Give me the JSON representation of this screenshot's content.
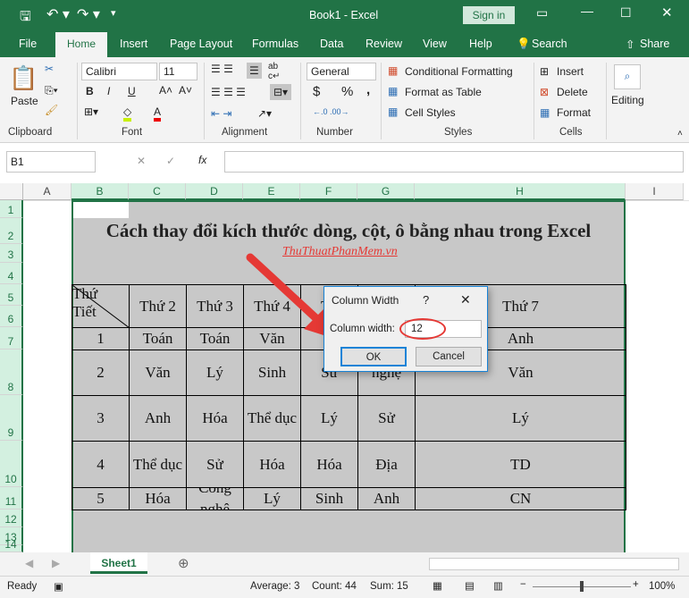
{
  "title": {
    "doc": "Book1  -  Excel",
    "signin": "Sign in"
  },
  "tabs": [
    "File",
    "Home",
    "Insert",
    "Page Layout",
    "Formulas",
    "Data",
    "Review",
    "View",
    "Help",
    "Search",
    "Share"
  ],
  "ribbon": {
    "clipboard": {
      "paste": "Paste",
      "label": "Clipboard"
    },
    "font": {
      "name": "Calibri",
      "size": "11",
      "label": "Font",
      "bold": "B",
      "italic": "I",
      "underline": "U"
    },
    "alignment": {
      "label": "Alignment"
    },
    "number": {
      "format": "General",
      "label": "Number",
      "currency": "$",
      "percent": "%",
      "comma": ","
    },
    "styles": {
      "conditional": "Conditional Formatting",
      "table": "Format as Table",
      "cell": "Cell Styles",
      "label": "Styles"
    },
    "cells": {
      "insert": "Insert",
      "delete": "Delete",
      "format": "Format",
      "label": "Cells"
    },
    "editing": {
      "label": "Editing"
    }
  },
  "formula_bar": {
    "name_box": "B1",
    "fx": "fx",
    "value": ""
  },
  "columns": [
    "A",
    "B",
    "C",
    "D",
    "E",
    "F",
    "G",
    "H",
    "I"
  ],
  "rows": [
    "1",
    "2",
    "3",
    "4",
    "5",
    "6",
    "7",
    "8",
    "9",
    "10",
    "11",
    "12",
    "13",
    "14"
  ],
  "sheet": {
    "title": "Cách thay đổi kích thước dòng, cột, ô bằng nhau trong Excel",
    "watermark": "ThuThuatPhanMem.vn",
    "corner_top": "Thứ",
    "corner_bottom": "Tiết",
    "headers": [
      "Thứ 2",
      "Thứ 3",
      "Thứ 4",
      "Th",
      "",
      "Thứ 7"
    ],
    "body": [
      [
        "1",
        "Toán",
        "Toán",
        "Văn",
        "T",
        "",
        "Anh"
      ],
      [
        "2",
        "Văn",
        "Lý",
        "Sinh",
        "Sử",
        "nghệ",
        "Văn"
      ],
      [
        "3",
        "Anh",
        "Hóa",
        "Thể dục",
        "Lý",
        "Sử",
        "Lý"
      ],
      [
        "4",
        "Thể dục",
        "Sử",
        "Hóa",
        "Hóa",
        "Địa",
        "TD"
      ],
      [
        "5",
        "Hóa",
        "Công nghệ",
        "Lý",
        "Sinh",
        "Anh",
        "CN"
      ]
    ]
  },
  "dialog": {
    "title": "Column Width",
    "help": "?",
    "close": "✕",
    "label": "Column width:",
    "value": "12",
    "ok": "OK",
    "cancel": "Cancel"
  },
  "sheet_tab": "Sheet1",
  "status": {
    "ready": "Ready",
    "average": "Average: 3",
    "count": "Count: 44",
    "sum": "Sum: 15",
    "zoom": "100%"
  },
  "colors": {
    "brand": "#217346",
    "fill": "#c8c8c8",
    "annot": "#e53935"
  }
}
